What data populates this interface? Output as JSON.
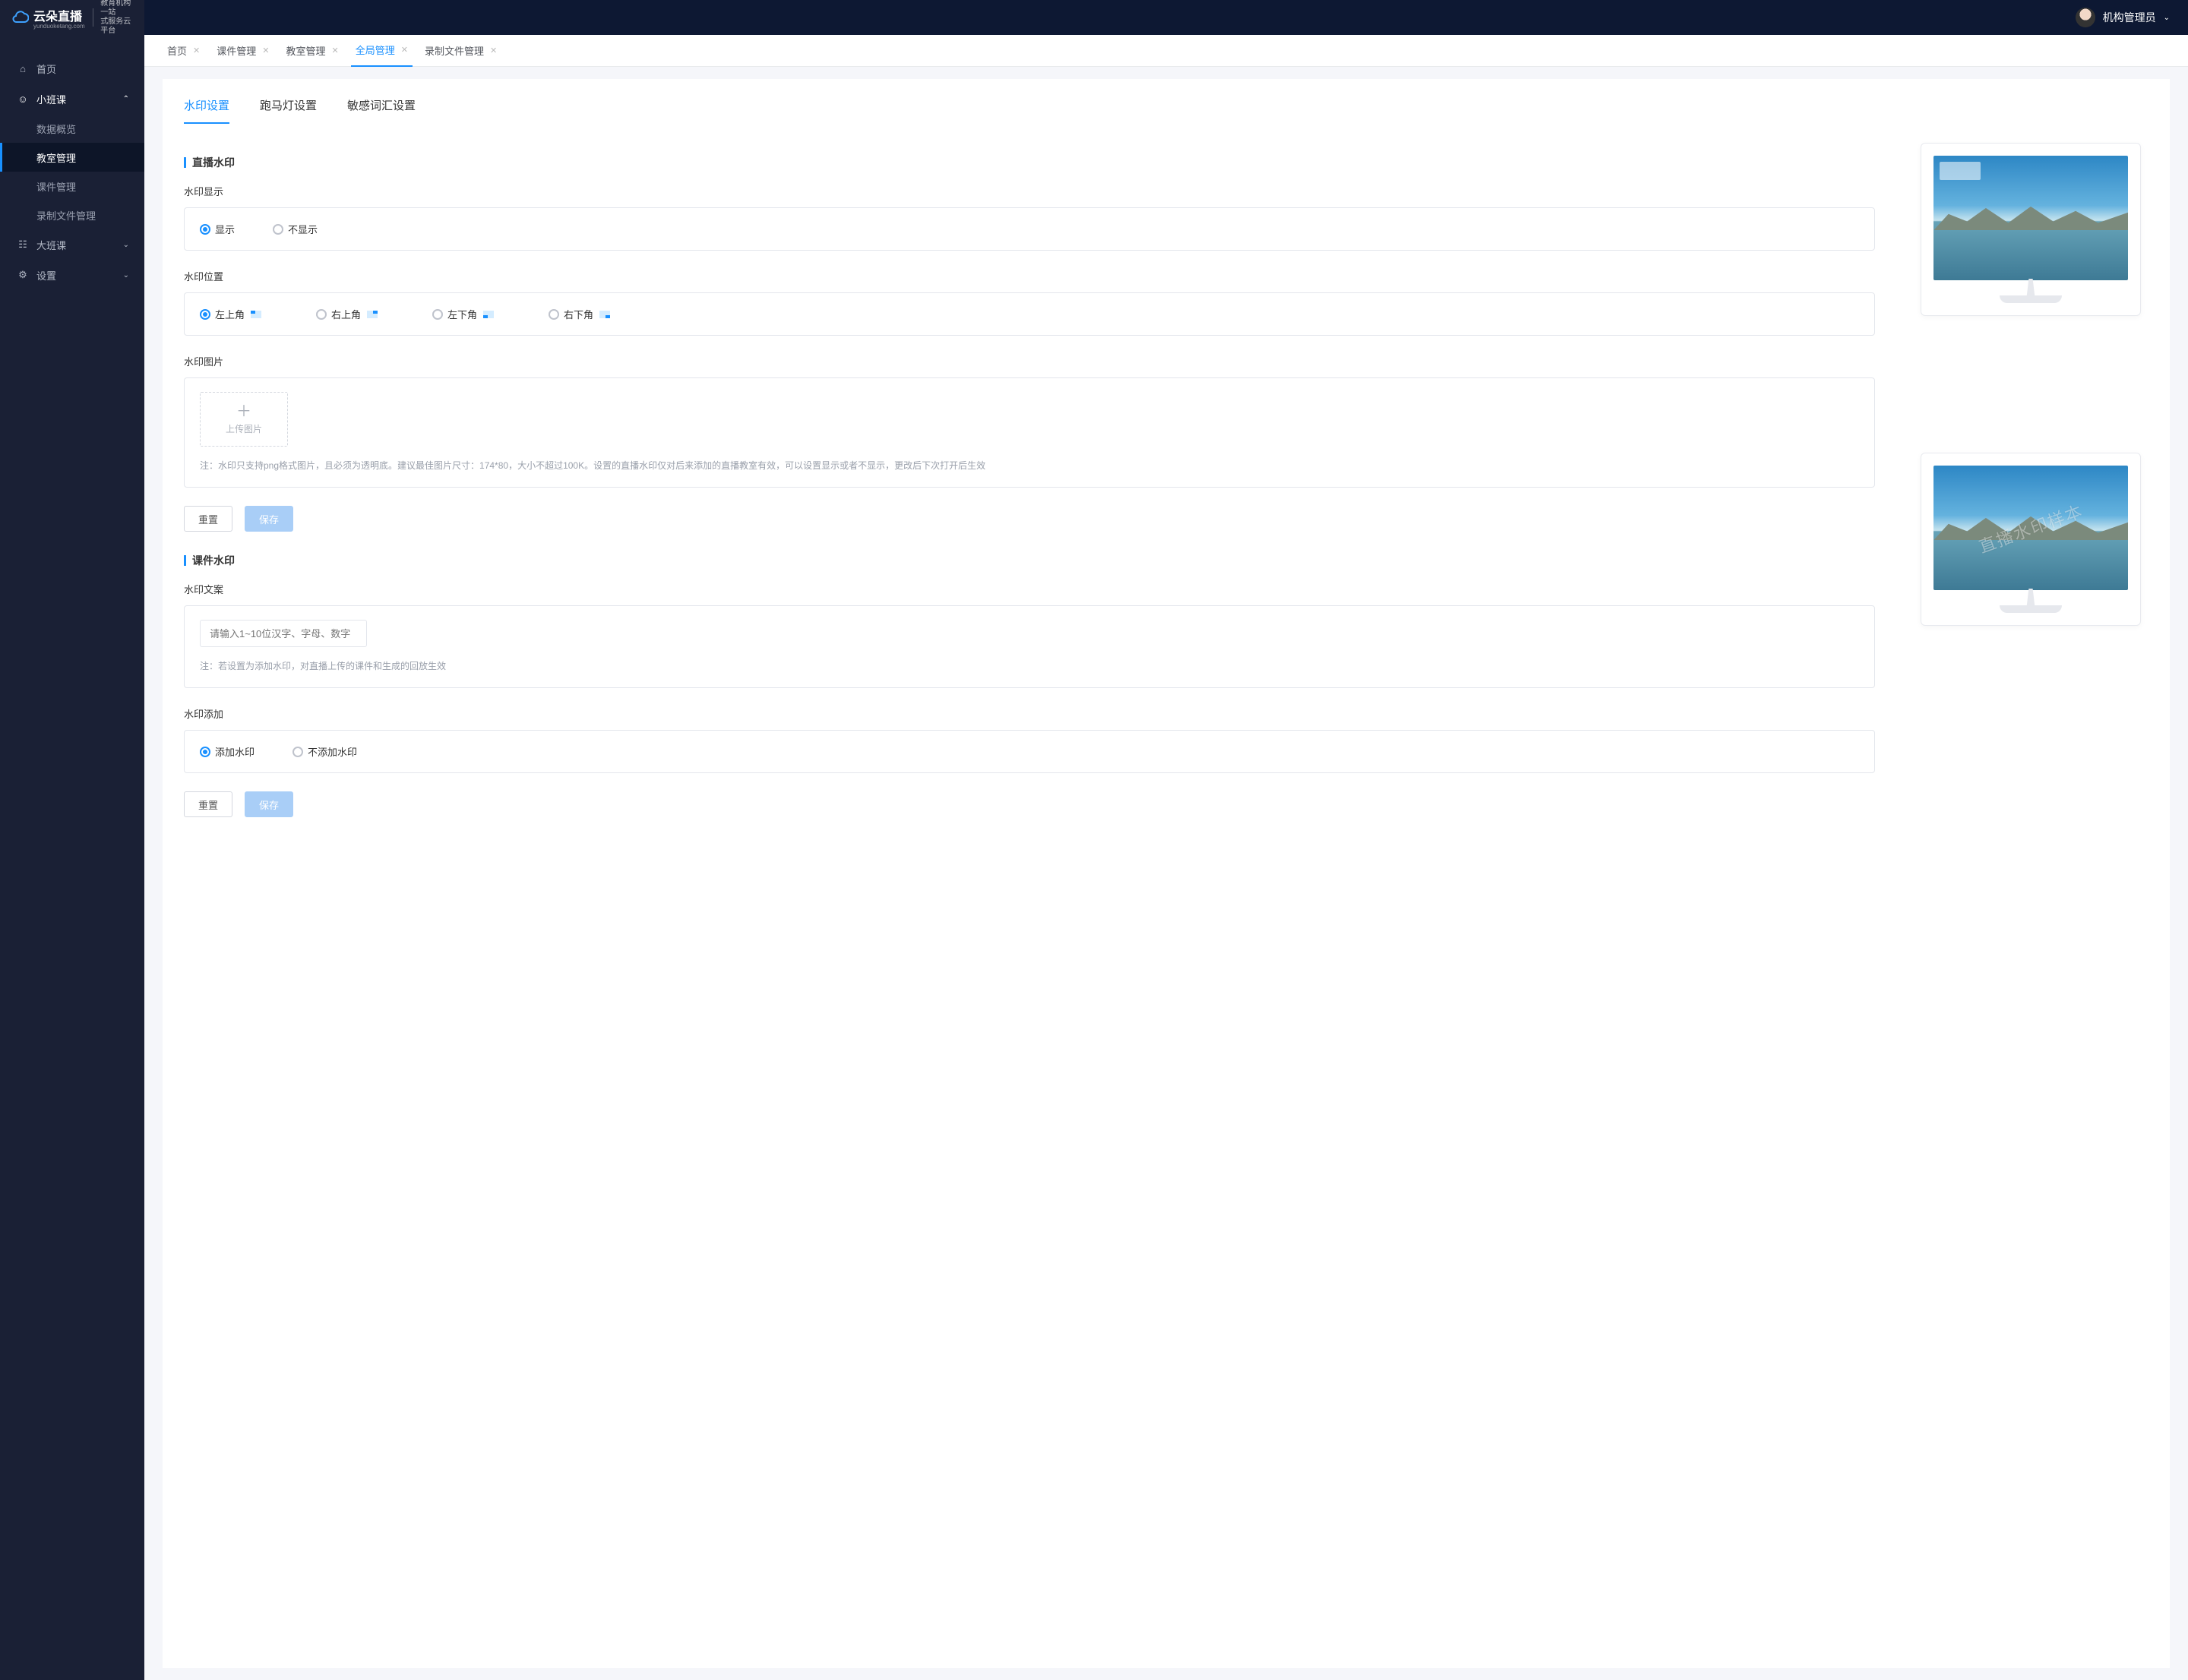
{
  "logo": {
    "brand": "云朵直播",
    "brand_sub": "yunduoketang.com",
    "tagline1": "教育机构一站",
    "tagline2": "式服务云平台"
  },
  "topbar": {
    "user": "机构管理员"
  },
  "nav": {
    "home": "首页",
    "small_class": "小班课",
    "small_sub": [
      {
        "label": "数据概览",
        "active": false
      },
      {
        "label": "教室管理",
        "active": true
      },
      {
        "label": "课件管理",
        "active": false
      },
      {
        "label": "录制文件管理",
        "active": false
      }
    ],
    "big_class": "大班课",
    "settings": "设置"
  },
  "tabs": [
    {
      "label": "首页",
      "active": false
    },
    {
      "label": "课件管理",
      "active": false
    },
    {
      "label": "教室管理",
      "active": false
    },
    {
      "label": "全局管理",
      "active": true
    },
    {
      "label": "录制文件管理",
      "active": false
    }
  ],
  "innerTabs": {
    "watermark": "水印设置",
    "marquee": "跑马灯设置",
    "sensitive": "敏感词汇设置"
  },
  "sec1": {
    "title": "直播水印",
    "dispLabel": "水印显示",
    "dispYes": "显示",
    "dispNo": "不显示",
    "posLabel": "水印位置",
    "tl": "左上角",
    "tr": "右上角",
    "bl": "左下角",
    "br": "右下角",
    "imgLabel": "水印图片",
    "upload": "上传图片",
    "hint": "注：水印只支持png格式图片，且必须为透明底。建议最佳图片尺寸：174*80，大小不超过100K。设置的直播水印仅对后来添加的直播教室有效，可以设置显示或者不显示，更改后下次打开后生效",
    "reset": "重置",
    "save": "保存"
  },
  "sec2": {
    "title": "课件水印",
    "textLabel": "水印文案",
    "placeholder": "请输入1~10位汉字、字母、数字",
    "hint": "注：若设置为添加水印，对直播上传的课件和生成的回放生效",
    "addLabel": "水印添加",
    "addYes": "添加水印",
    "addNo": "不添加水印",
    "reset": "重置",
    "save": "保存",
    "sample": "直播水印样本"
  }
}
